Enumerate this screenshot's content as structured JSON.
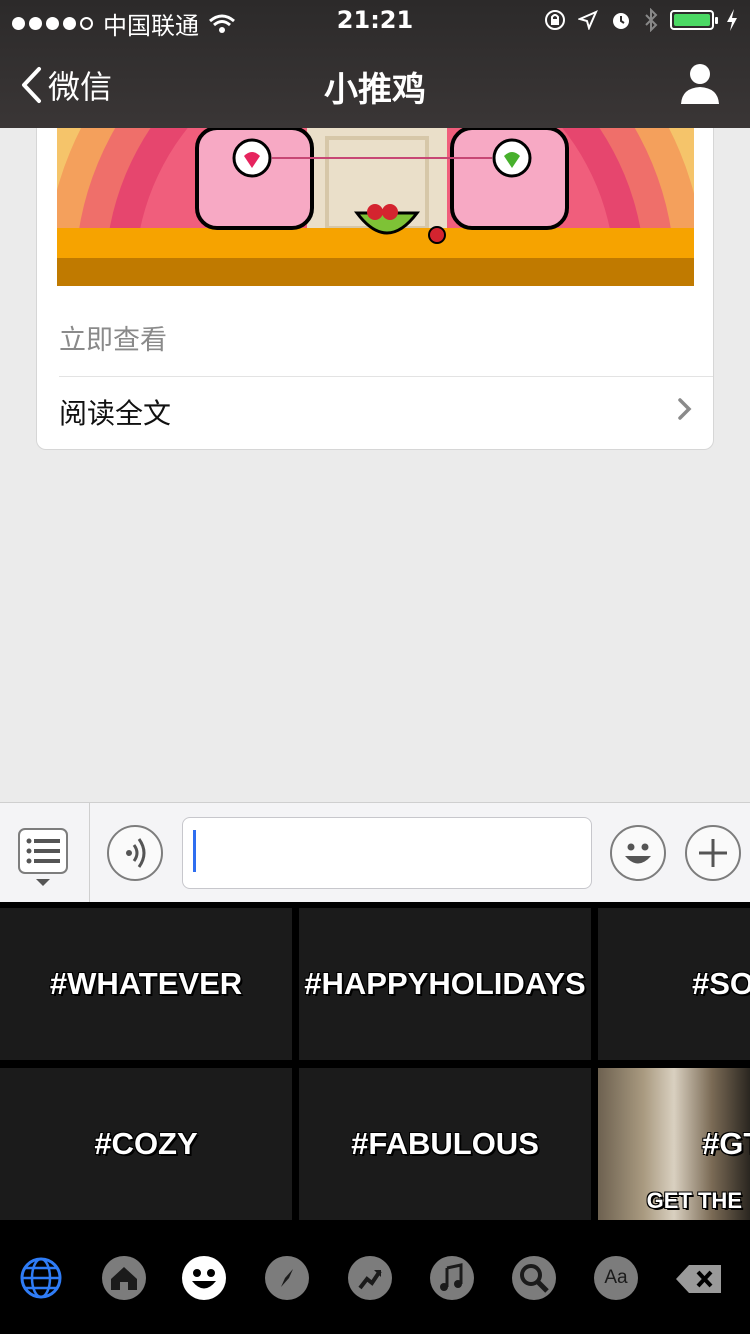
{
  "status_bar": {
    "carrier": "中国联通",
    "time": "21:21",
    "battery_level": 1.0
  },
  "nav": {
    "back_label": "微信",
    "title": "小推鸡"
  },
  "article_card": {
    "more_link": "立即查看",
    "read_full": "阅读全文"
  },
  "input_bar": {
    "text_value": ""
  },
  "sticker_tiles": [
    {
      "label": "#WHATEVER"
    },
    {
      "label": "#HAPPYHOLIDAYS"
    },
    {
      "label": "#SO"
    },
    {
      "label": "#COZY"
    },
    {
      "label": "#FABULOUS"
    },
    {
      "label": "#GT",
      "overlay": "GET THE"
    }
  ],
  "keyboard_toolbar": [
    {
      "icon": "globe-icon"
    },
    {
      "icon": "home-icon"
    },
    {
      "icon": "smiley-face-icon"
    },
    {
      "icon": "compass-icon"
    },
    {
      "icon": "trending-icon"
    },
    {
      "icon": "music-note-icon"
    },
    {
      "icon": "search-icon"
    },
    {
      "icon": "text-aa-icon",
      "label": "Aa"
    },
    {
      "icon": "delete-icon"
    }
  ],
  "colors": {
    "nav_bg": "#2c2a2a",
    "accent_blue": "#2f6ef0",
    "battery_green": "#4cd964"
  }
}
